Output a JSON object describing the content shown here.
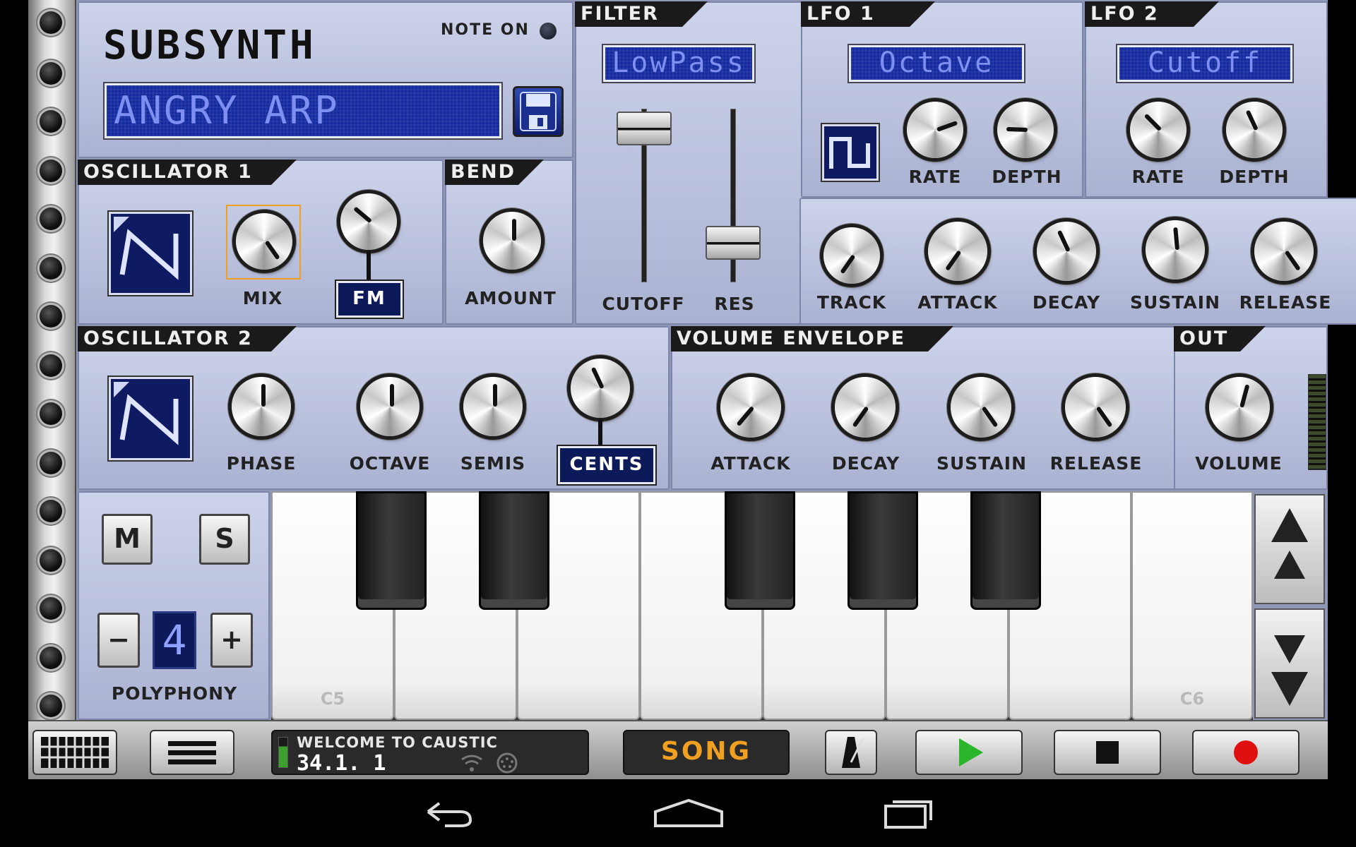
{
  "synth": {
    "name": "SUBSYNTH",
    "note_on_label": "NOTE ON",
    "preset_name": "ANGRY ARP",
    "save_icon": "floppy-disk-icon"
  },
  "sections": {
    "osc1": "OSCILLATOR 1",
    "bend": "BEND",
    "filter": "FILTER",
    "lfo1": "LFO 1",
    "lfo2": "LFO 2",
    "osc2": "OSCILLATOR 2",
    "vol_env": "VOLUME ENVELOPE",
    "out": "OUT"
  },
  "osc1": {
    "waveform_icon": "sawtooth-wave-icon",
    "mix_label": "MIX",
    "fm_label": "FM"
  },
  "bend": {
    "amount_label": "AMOUNT"
  },
  "filter": {
    "type": "LowPass",
    "cutoff_label": "CUTOFF",
    "res_label": "RES",
    "track_label": "TRACK",
    "attack_label": "ATTACK",
    "decay_label": "DECAY",
    "sustain_label": "SUSTAIN",
    "release_label": "RELEASE"
  },
  "lfo1": {
    "target": "Octave",
    "waveform_icon": "square-wave-icon",
    "rate_label": "RATE",
    "depth_label": "DEPTH"
  },
  "lfo2": {
    "target": "Cutoff",
    "rate_label": "RATE",
    "depth_label": "DEPTH"
  },
  "osc2": {
    "waveform_icon": "sawtooth-wave-icon",
    "phase_label": "PHASE",
    "octave_label": "OCTAVE",
    "semis_label": "SEMIS",
    "cents_label": "CENTS"
  },
  "vol_env": {
    "attack_label": "ATTACK",
    "decay_label": "DECAY",
    "sustain_label": "SUSTAIN",
    "release_label": "RELEASE"
  },
  "out": {
    "volume_label": "VOLUME"
  },
  "voice": {
    "mute_label": "M",
    "solo_label": "S",
    "minus_label": "−",
    "plus_label": "+",
    "polyphony_value": "4",
    "polyphony_label": "POLYPHONY"
  },
  "keyboard": {
    "c5_label": "C5",
    "c6_label": "C6",
    "octave_up_icon": "double-chevron-up-icon",
    "octave_down_icon": "double-chevron-down-icon"
  },
  "transport": {
    "welcome_text": "WELCOME TO CAUSTIC",
    "position": "34.1. 1",
    "song_label": "SONG",
    "play_color": "#2bb52b",
    "record_color": "#e01010"
  },
  "colors": {
    "panel": "#c3c9e4",
    "lcd_bg": "#142a9e",
    "lcd_text": "#7d8ff0",
    "song_text": "#f0a020",
    "highlight": "#f0a020"
  }
}
